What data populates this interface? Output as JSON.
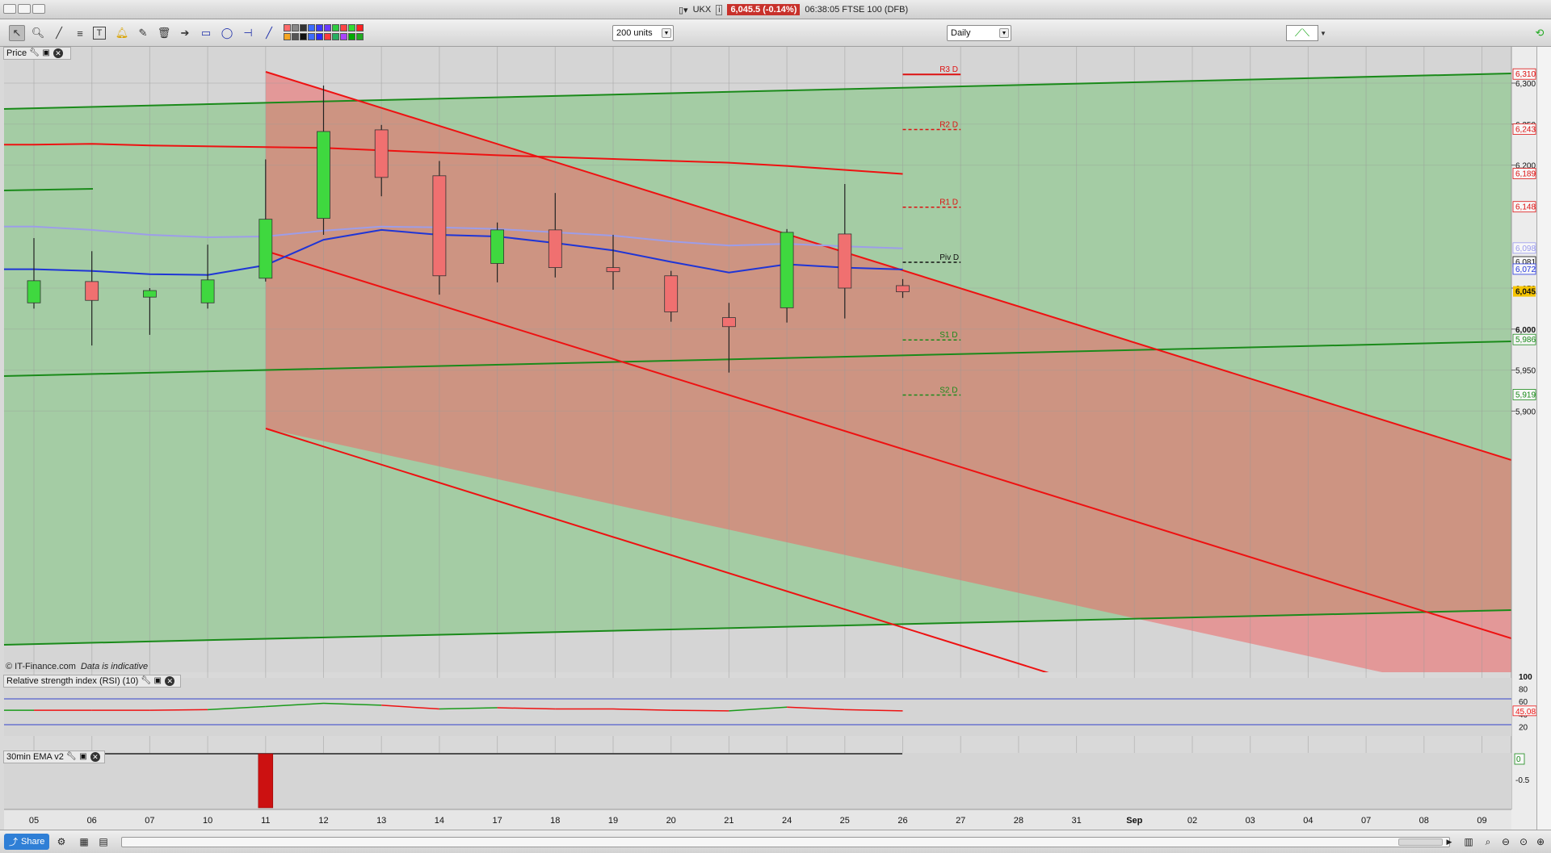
{
  "window": {
    "symbol": "UKX",
    "price_badge": "6,045.5 (-0.14%)",
    "time_instrument": "06:38:05 FTSE 100 (DFB)"
  },
  "toolbar": {
    "units_select": "200 units",
    "period_select": "Daily",
    "tool_icons": [
      "pointer-icon",
      "zoom-icon",
      "draw-line-icon",
      "fibonacci-icon",
      "text-icon",
      "alert-icon",
      "pencil-icon",
      "trash-icon",
      "arrow-icon",
      "rectangle-icon",
      "lasso-icon",
      "horizontal-line-icon",
      "trend-line-icon"
    ],
    "palette": [
      "#ff6b6b",
      "#f5a623",
      "#888888",
      "#555555",
      "#333333",
      "#111111",
      "#3b6cff",
      "#3b6cff",
      "#3b3bff",
      "#2a2aff",
      "#6a3bff",
      "#ff3b3b",
      "#2ecc40",
      "#27ae60",
      "#ff4444",
      "#aa44ff",
      "#33dd33",
      "#00aa00",
      "#ff2222",
      "#22aa22"
    ]
  },
  "price_panel": {
    "label": "Price",
    "watermark": "© IT-Finance.com",
    "watermark_note": "Data is indicative",
    "axis_ticks": [
      "6,300",
      "6,250",
      "6,200",
      "6,050",
      "6,000",
      "5,950",
      "5,900"
    ],
    "tagged_values": [
      {
        "text": "6,310.6",
        "color": "#d11"
      },
      {
        "text": "6,243.4",
        "color": "#d11"
      },
      {
        "text": "6,189.3",
        "color": "#d11"
      },
      {
        "text": "6,148.7",
        "color": "#d11"
      },
      {
        "text": "6,098.4",
        "color": "#9999ee"
      },
      {
        "text": "6,081.5",
        "color": "#111"
      },
      {
        "text": "6,072.7",
        "color": "#2233dd"
      },
      {
        "text": "6,045.5",
        "color": "#111",
        "bg": "#f5c400"
      },
      {
        "text": "5,986.8",
        "color": "#1a8a1a"
      },
      {
        "text": "5,919.6",
        "color": "#1a8a1a"
      }
    ],
    "pivots": [
      {
        "label": "R3 D",
        "value": 6310.6,
        "color": "#d11",
        "dashed": false
      },
      {
        "label": "R2 D",
        "value": 6243.4,
        "color": "#d11",
        "dashed": true
      },
      {
        "label": "R1 D",
        "value": 6148.7,
        "color": "#d11",
        "dashed": true
      },
      {
        "label": "Piv D",
        "value": 6081.5,
        "color": "#111",
        "dashed": true
      },
      {
        "label": "S1 D",
        "value": 5986.8,
        "color": "#1a8a1a",
        "dashed": true
      },
      {
        "label": "S2 D",
        "value": 5919.6,
        "color": "#1a8a1a",
        "dashed": true
      }
    ]
  },
  "rsi_panel": {
    "label": "Relative strength index (RSI) (10)",
    "axis_ticks": [
      "100",
      "80",
      "60",
      "40",
      "20"
    ],
    "current_value": "45.083"
  },
  "ema_panel": {
    "label": "30min EMA v2",
    "current_value": "0",
    "axis_tick": "-0.5"
  },
  "x_axis": {
    "labels": [
      "05",
      "06",
      "07",
      "10",
      "11",
      "12",
      "13",
      "14",
      "17",
      "18",
      "19",
      "20",
      "21",
      "24",
      "25",
      "26",
      "27",
      "28",
      "31",
      "Sep",
      "02",
      "03",
      "04",
      "07",
      "08",
      "09"
    ]
  },
  "chart_data": {
    "type": "candlestick",
    "title": "",
    "ylim": [
      5825,
      6345
    ],
    "candles": [
      {
        "date": "05",
        "open": 6032,
        "high": 6111,
        "low": 6025,
        "close": 6059
      },
      {
        "date": "06",
        "open": 6058,
        "high": 6095,
        "low": 5980,
        "close": 6035
      },
      {
        "date": "07",
        "open": 6039,
        "high": 6050,
        "low": 5993,
        "close": 6047
      },
      {
        "date": "10",
        "open": 6032,
        "high": 6103,
        "low": 6025,
        "close": 6060
      },
      {
        "date": "11",
        "open": 6062,
        "high": 6207,
        "low": 6058,
        "close": 6134
      },
      {
        "date": "12",
        "open": 6135,
        "high": 6297,
        "low": 6115,
        "close": 6241
      },
      {
        "date": "13",
        "open": 6243,
        "high": 6249,
        "low": 6162,
        "close": 6185
      },
      {
        "date": "14",
        "open": 6187,
        "high": 6205,
        "low": 6042,
        "close": 6065
      },
      {
        "date": "17",
        "open": 6080,
        "high": 6130,
        "low": 6057,
        "close": 6121
      },
      {
        "date": "18",
        "open": 6121,
        "high": 6166,
        "low": 6063,
        "close": 6075
      },
      {
        "date": "19",
        "open": 6075,
        "high": 6115,
        "low": 6048,
        "close": 6070
      },
      {
        "date": "20",
        "open": 6065,
        "high": 6071,
        "low": 6009,
        "close": 6021
      },
      {
        "date": "21",
        "open": 6014,
        "high": 6032,
        "low": 5947,
        "close": 6003
      },
      {
        "date": "24",
        "open": 6026,
        "high": 6122,
        "low": 6008,
        "close": 6118
      },
      {
        "date": "25",
        "open": 6116,
        "high": 6177,
        "low": 6013,
        "close": 6050
      },
      {
        "date": "26",
        "open": 6053,
        "high": 6061,
        "low": 6038,
        "close": 6045.5
      }
    ],
    "ma_blue": [
      6073,
      6071,
      6067,
      6066,
      6078,
      6109,
      6121,
      6115,
      6113,
      6105,
      6096,
      6082,
      6069,
      6079,
      6075,
      6072.7
    ],
    "ma_lavender": [
      6125,
      6121,
      6115,
      6112,
      6113,
      6120,
      6125,
      6124,
      6122,
      6118,
      6114,
      6107,
      6102,
      6104,
      6101,
      6098.4
    ],
    "ma_red_long": [
      {
        "date": "05",
        "value": 6225
      },
      {
        "date": "06",
        "value": 6226
      },
      {
        "date": "07",
        "value": 6224
      },
      {
        "date": "12",
        "value": 6221
      },
      {
        "date": "17",
        "value": 6212
      },
      {
        "date": "21",
        "value": 6203
      },
      {
        "date": "24",
        "value": 6199
      },
      {
        "date": "26",
        "value": 6189.3
      }
    ],
    "rsi": [
      46,
      46,
      46,
      47,
      52,
      57,
      54,
      48,
      50,
      48,
      48,
      46,
      45,
      51,
      47,
      45.083
    ],
    "ema_histogram": [
      {
        "date": "11",
        "value": -0.5
      }
    ]
  }
}
